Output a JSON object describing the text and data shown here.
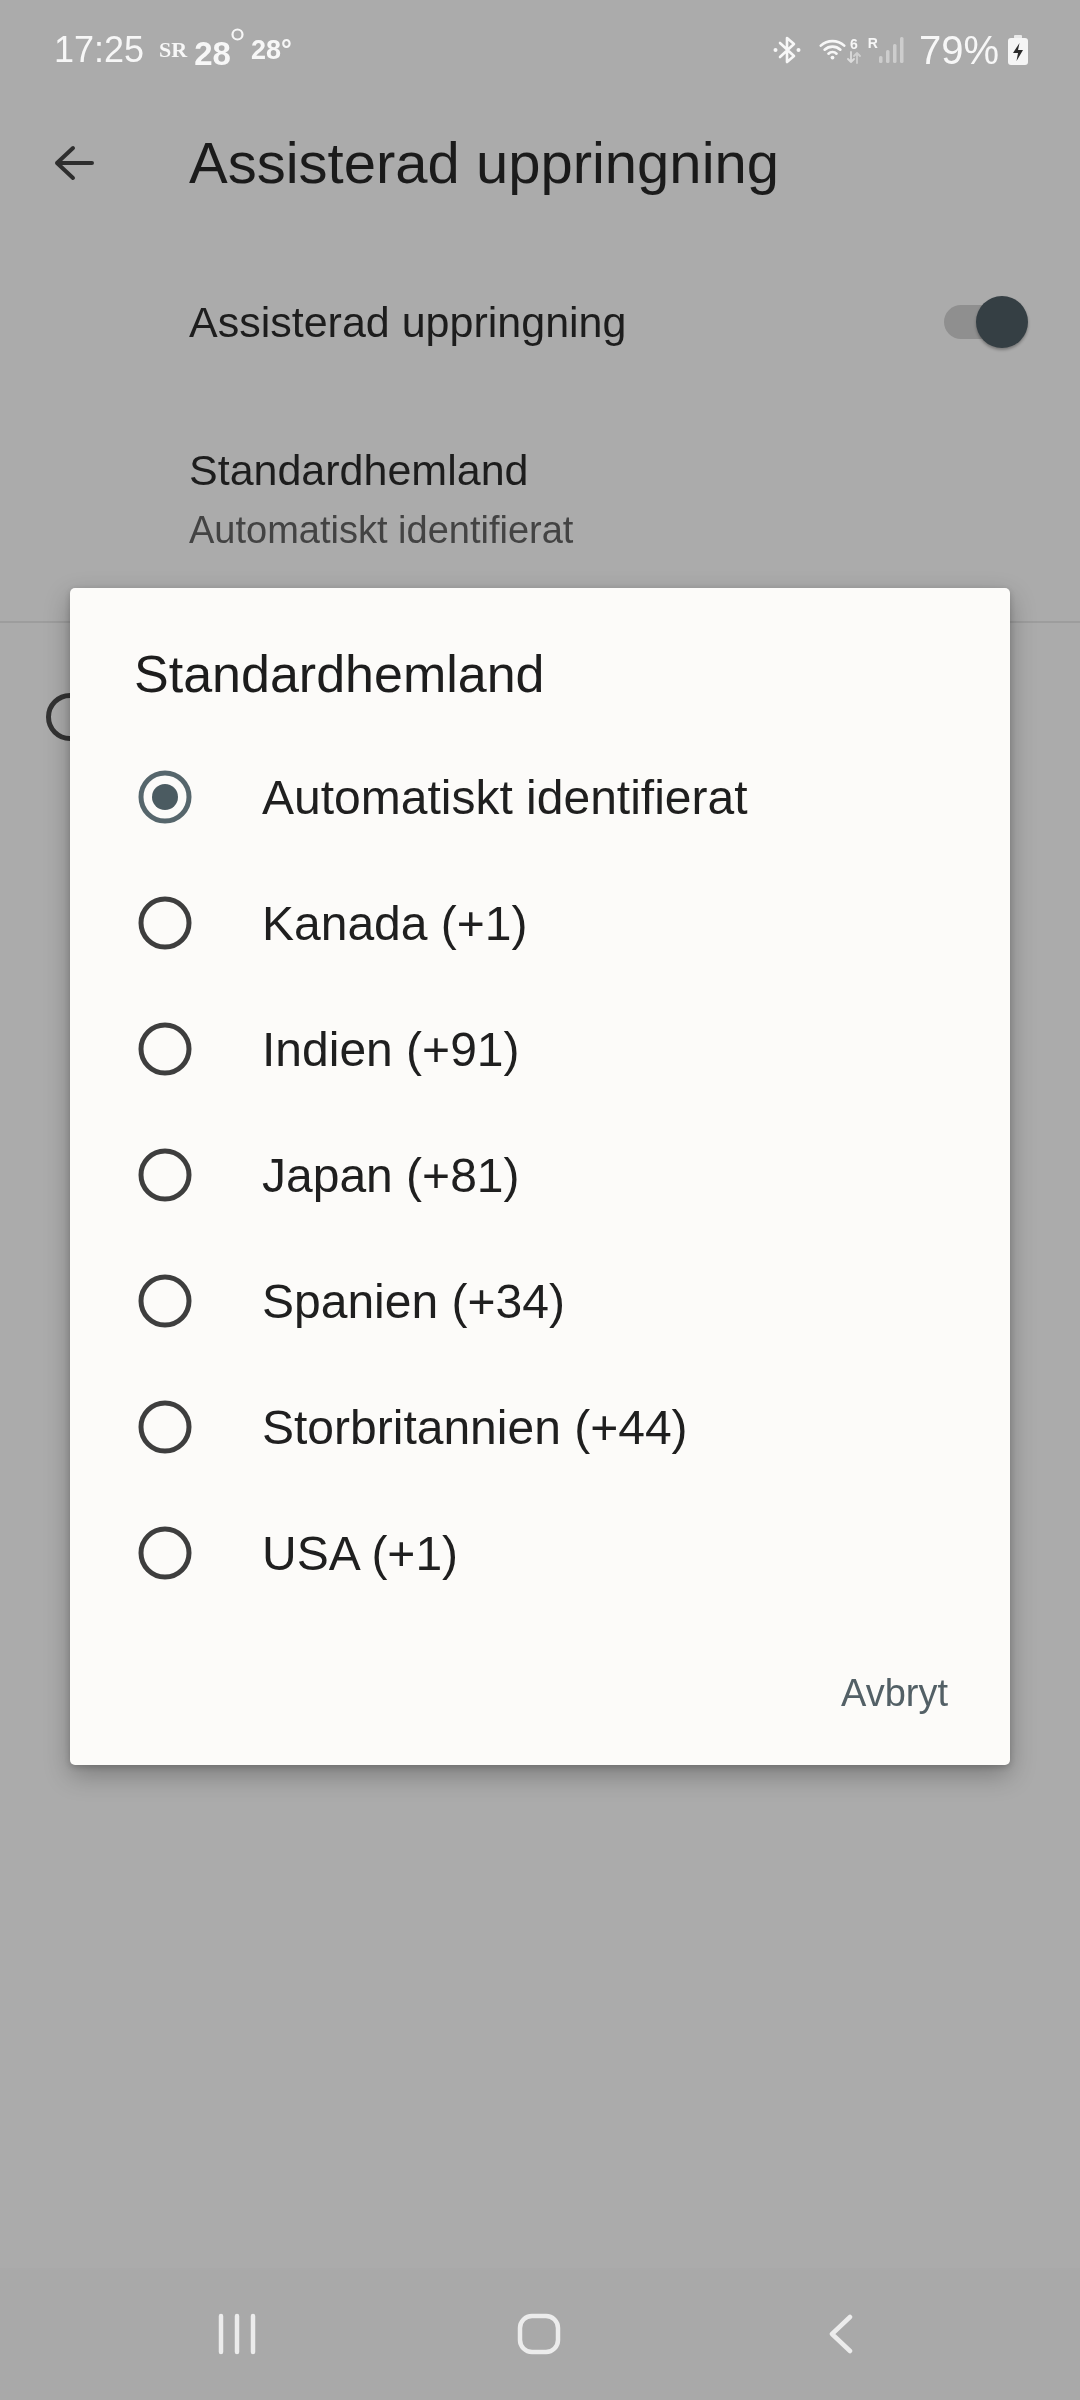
{
  "status_bar": {
    "time": "17:25",
    "notifications": [
      {
        "kind": "logo",
        "text": "SR"
      },
      {
        "kind": "weather",
        "text": "28"
      },
      {
        "kind": "temperature",
        "text": "28°"
      }
    ],
    "wifi_badge": "6",
    "signal_badge": "R",
    "battery": "79%",
    "charging": true
  },
  "app_bar": {
    "title": "Assisterad uppringning"
  },
  "settings": [
    {
      "kind": "switch",
      "title": "Assisterad uppringning",
      "on": true
    },
    {
      "kind": "value",
      "title": "Standardhemland",
      "summary": "Automatiskt identifierat"
    }
  ],
  "dialog": {
    "title": "Standardhemland",
    "options": [
      {
        "label": "Automatiskt identifierat",
        "selected": true
      },
      {
        "label": "Kanada (+1)",
        "selected": false
      },
      {
        "label": "Indien (+91)",
        "selected": false
      },
      {
        "label": "Japan (+81)",
        "selected": false
      },
      {
        "label": "Spanien (+34)",
        "selected": false
      },
      {
        "label": "Storbritannien (+44)",
        "selected": false
      },
      {
        "label": "USA (+1)",
        "selected": false
      }
    ],
    "buttons": [
      "Avbryt"
    ]
  }
}
